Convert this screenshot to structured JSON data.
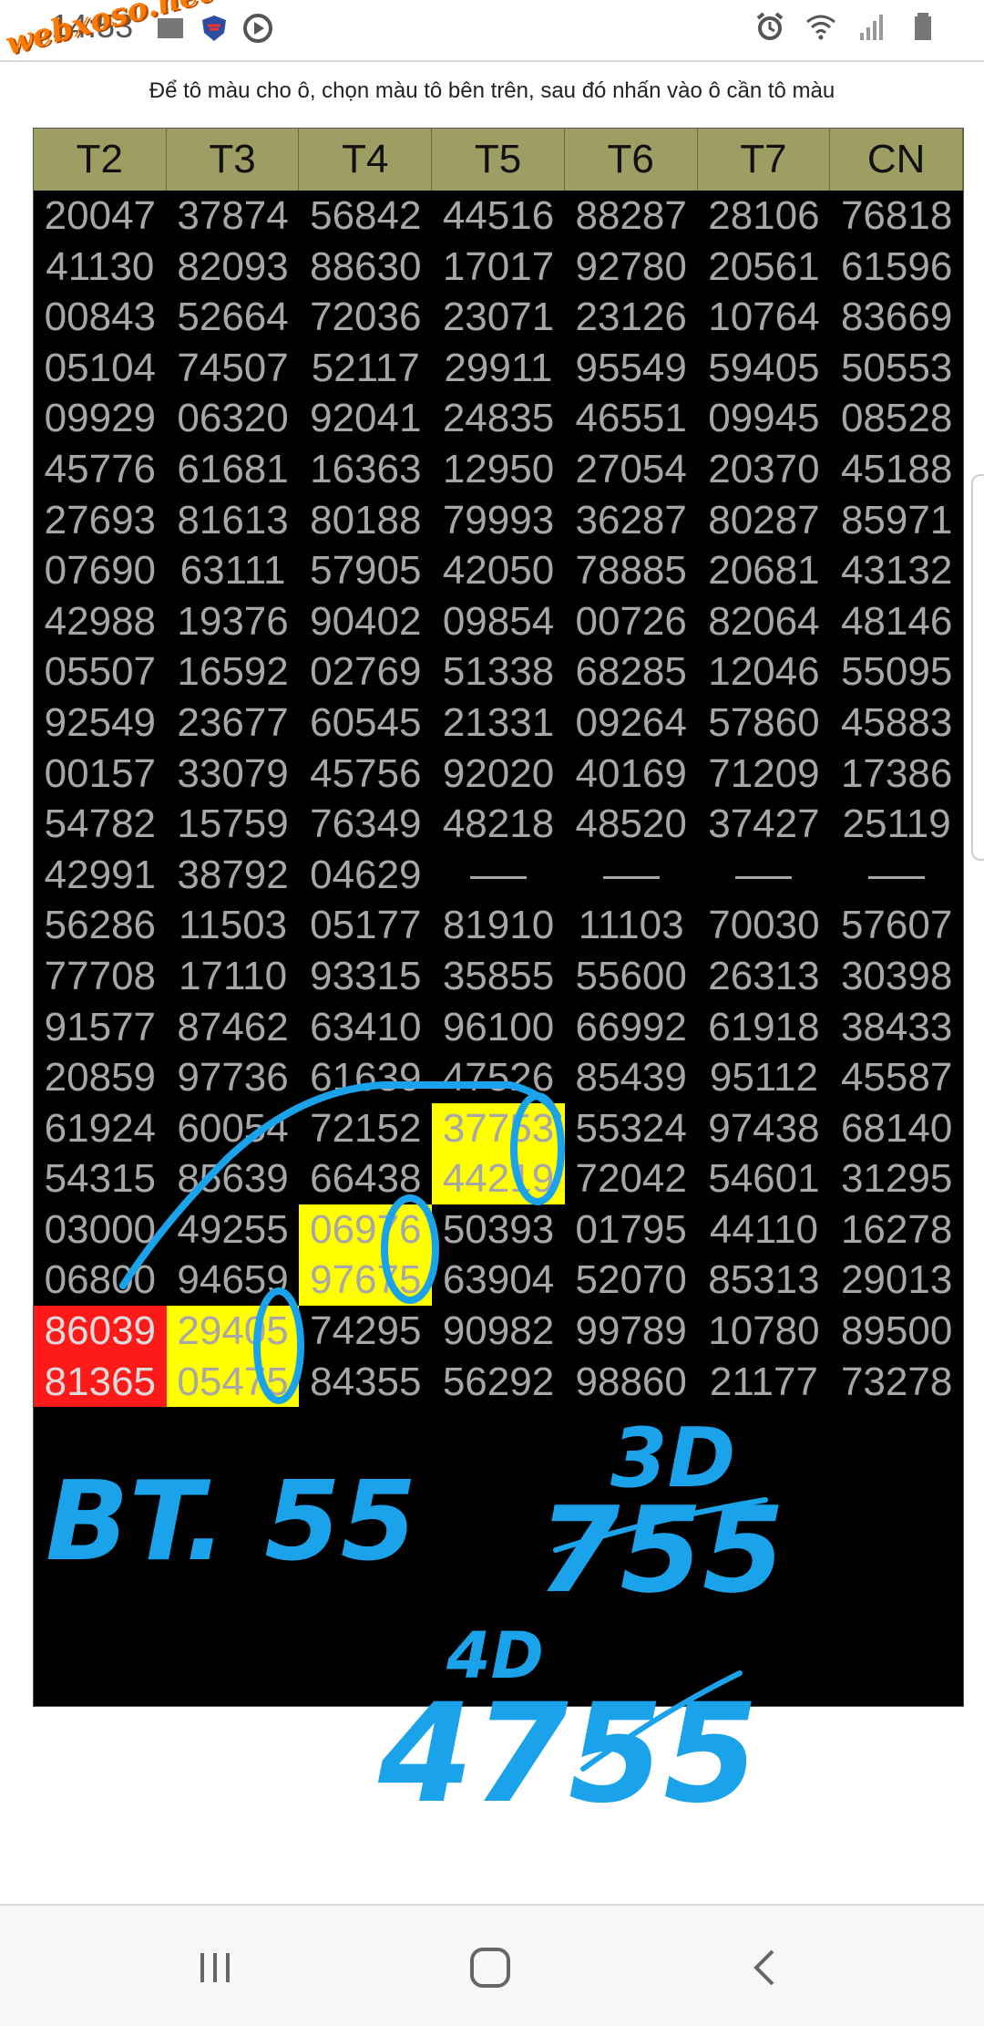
{
  "status_bar": {
    "time": "14:53"
  },
  "watermark": "webxoso.net",
  "instruction": "Để tô màu cho ô, chọn màu tô bên trên, sau đó nhấn vào ô cần tô màu",
  "columns": [
    "T2",
    "T3",
    "T4",
    "T5",
    "T6",
    "T7",
    "CN"
  ],
  "rows": [
    [
      "20047",
      "37874",
      "56842",
      "44516",
      "88287",
      "28106",
      "76818"
    ],
    [
      "41130",
      "82093",
      "88630",
      "17017",
      "92780",
      "20561",
      "61596"
    ],
    [
      "00843",
      "52664",
      "72036",
      "23071",
      "23126",
      "10764",
      "83669"
    ],
    [
      "05104",
      "74507",
      "52117",
      "29911",
      "95549",
      "59405",
      "50553"
    ],
    [
      "09929",
      "06320",
      "92041",
      "24835",
      "46551",
      "09945",
      "08528"
    ],
    [
      "45776",
      "61681",
      "16363",
      "12950",
      "27054",
      "20370",
      "45188"
    ],
    [
      "27693",
      "81613",
      "80188",
      "79993",
      "36287",
      "80287",
      "85971"
    ],
    [
      "07690",
      "63111",
      "57905",
      "42050",
      "78885",
      "20681",
      "43132"
    ],
    [
      "42988",
      "19376",
      "90402",
      "09854",
      "00726",
      "82064",
      "48146"
    ],
    [
      "05507",
      "16592",
      "02769",
      "51338",
      "68285",
      "12046",
      "55095"
    ],
    [
      "92549",
      "23677",
      "60545",
      "21331",
      "09264",
      "57860",
      "45883"
    ],
    [
      "00157",
      "33079",
      "45756",
      "92020",
      "40169",
      "71209",
      "17386"
    ],
    [
      "54782",
      "15759",
      "76349",
      "48218",
      "48520",
      "37427",
      "25119"
    ],
    [
      "42991",
      "38792",
      "04629",
      "—",
      "—",
      "—",
      "—"
    ],
    [
      "56286",
      "11503",
      "05177",
      "81910",
      "11103",
      "70030",
      "57607"
    ],
    [
      "77708",
      "17110",
      "93315",
      "35855",
      "55600",
      "26313",
      "30398"
    ],
    [
      "91577",
      "87462",
      "63410",
      "96100",
      "66992",
      "61918",
      "38433"
    ],
    [
      "20859",
      "97736",
      "61639",
      "47526",
      "85439",
      "95112",
      "45587"
    ],
    [
      "61924",
      "60054",
      "72152",
      "37753",
      "55324",
      "97438",
      "68140"
    ],
    [
      "54315",
      "85639",
      "66438",
      "44219",
      "72042",
      "54601",
      "31295"
    ],
    [
      "03000",
      "49255",
      "06976",
      "50393",
      "01795",
      "44110",
      "16278"
    ],
    [
      "06800",
      "94659",
      "97675",
      "63904",
      "52070",
      "85313",
      "29013"
    ],
    [
      "86039",
      "29405",
      "74295",
      "90982",
      "99789",
      "10780",
      "89500"
    ],
    [
      "81365",
      "05475",
      "84355",
      "56292",
      "98860",
      "21177",
      "73278"
    ]
  ],
  "highlights": {
    "yellow": [
      [
        18,
        3
      ],
      [
        19,
        3
      ],
      [
        20,
        2
      ],
      [
        21,
        2
      ],
      [
        22,
        1
      ],
      [
        23,
        1
      ]
    ],
    "red": [
      [
        22,
        0
      ],
      [
        23,
        0
      ]
    ]
  },
  "handwriting": {
    "note_left": "BT. 55",
    "note_3d_label": "3D",
    "note_3d_value": "755",
    "note_4d_label": "4D",
    "note_4d_value": "4755"
  },
  "colors": {
    "header_bg": "#9e9d64",
    "board_bg": "#000000",
    "number_text": "#a7a7a7",
    "highlight_yellow": "#ffff00",
    "highlight_red": "#ff1a1a",
    "ink": "#1aa3ea"
  },
  "icons": [
    "alarm-icon",
    "wifi-icon",
    "signal-icon",
    "battery-icon",
    "shield-app-icon",
    "media-app-icon"
  ],
  "navigation": [
    "recent-apps-button",
    "home-button",
    "back-button"
  ]
}
